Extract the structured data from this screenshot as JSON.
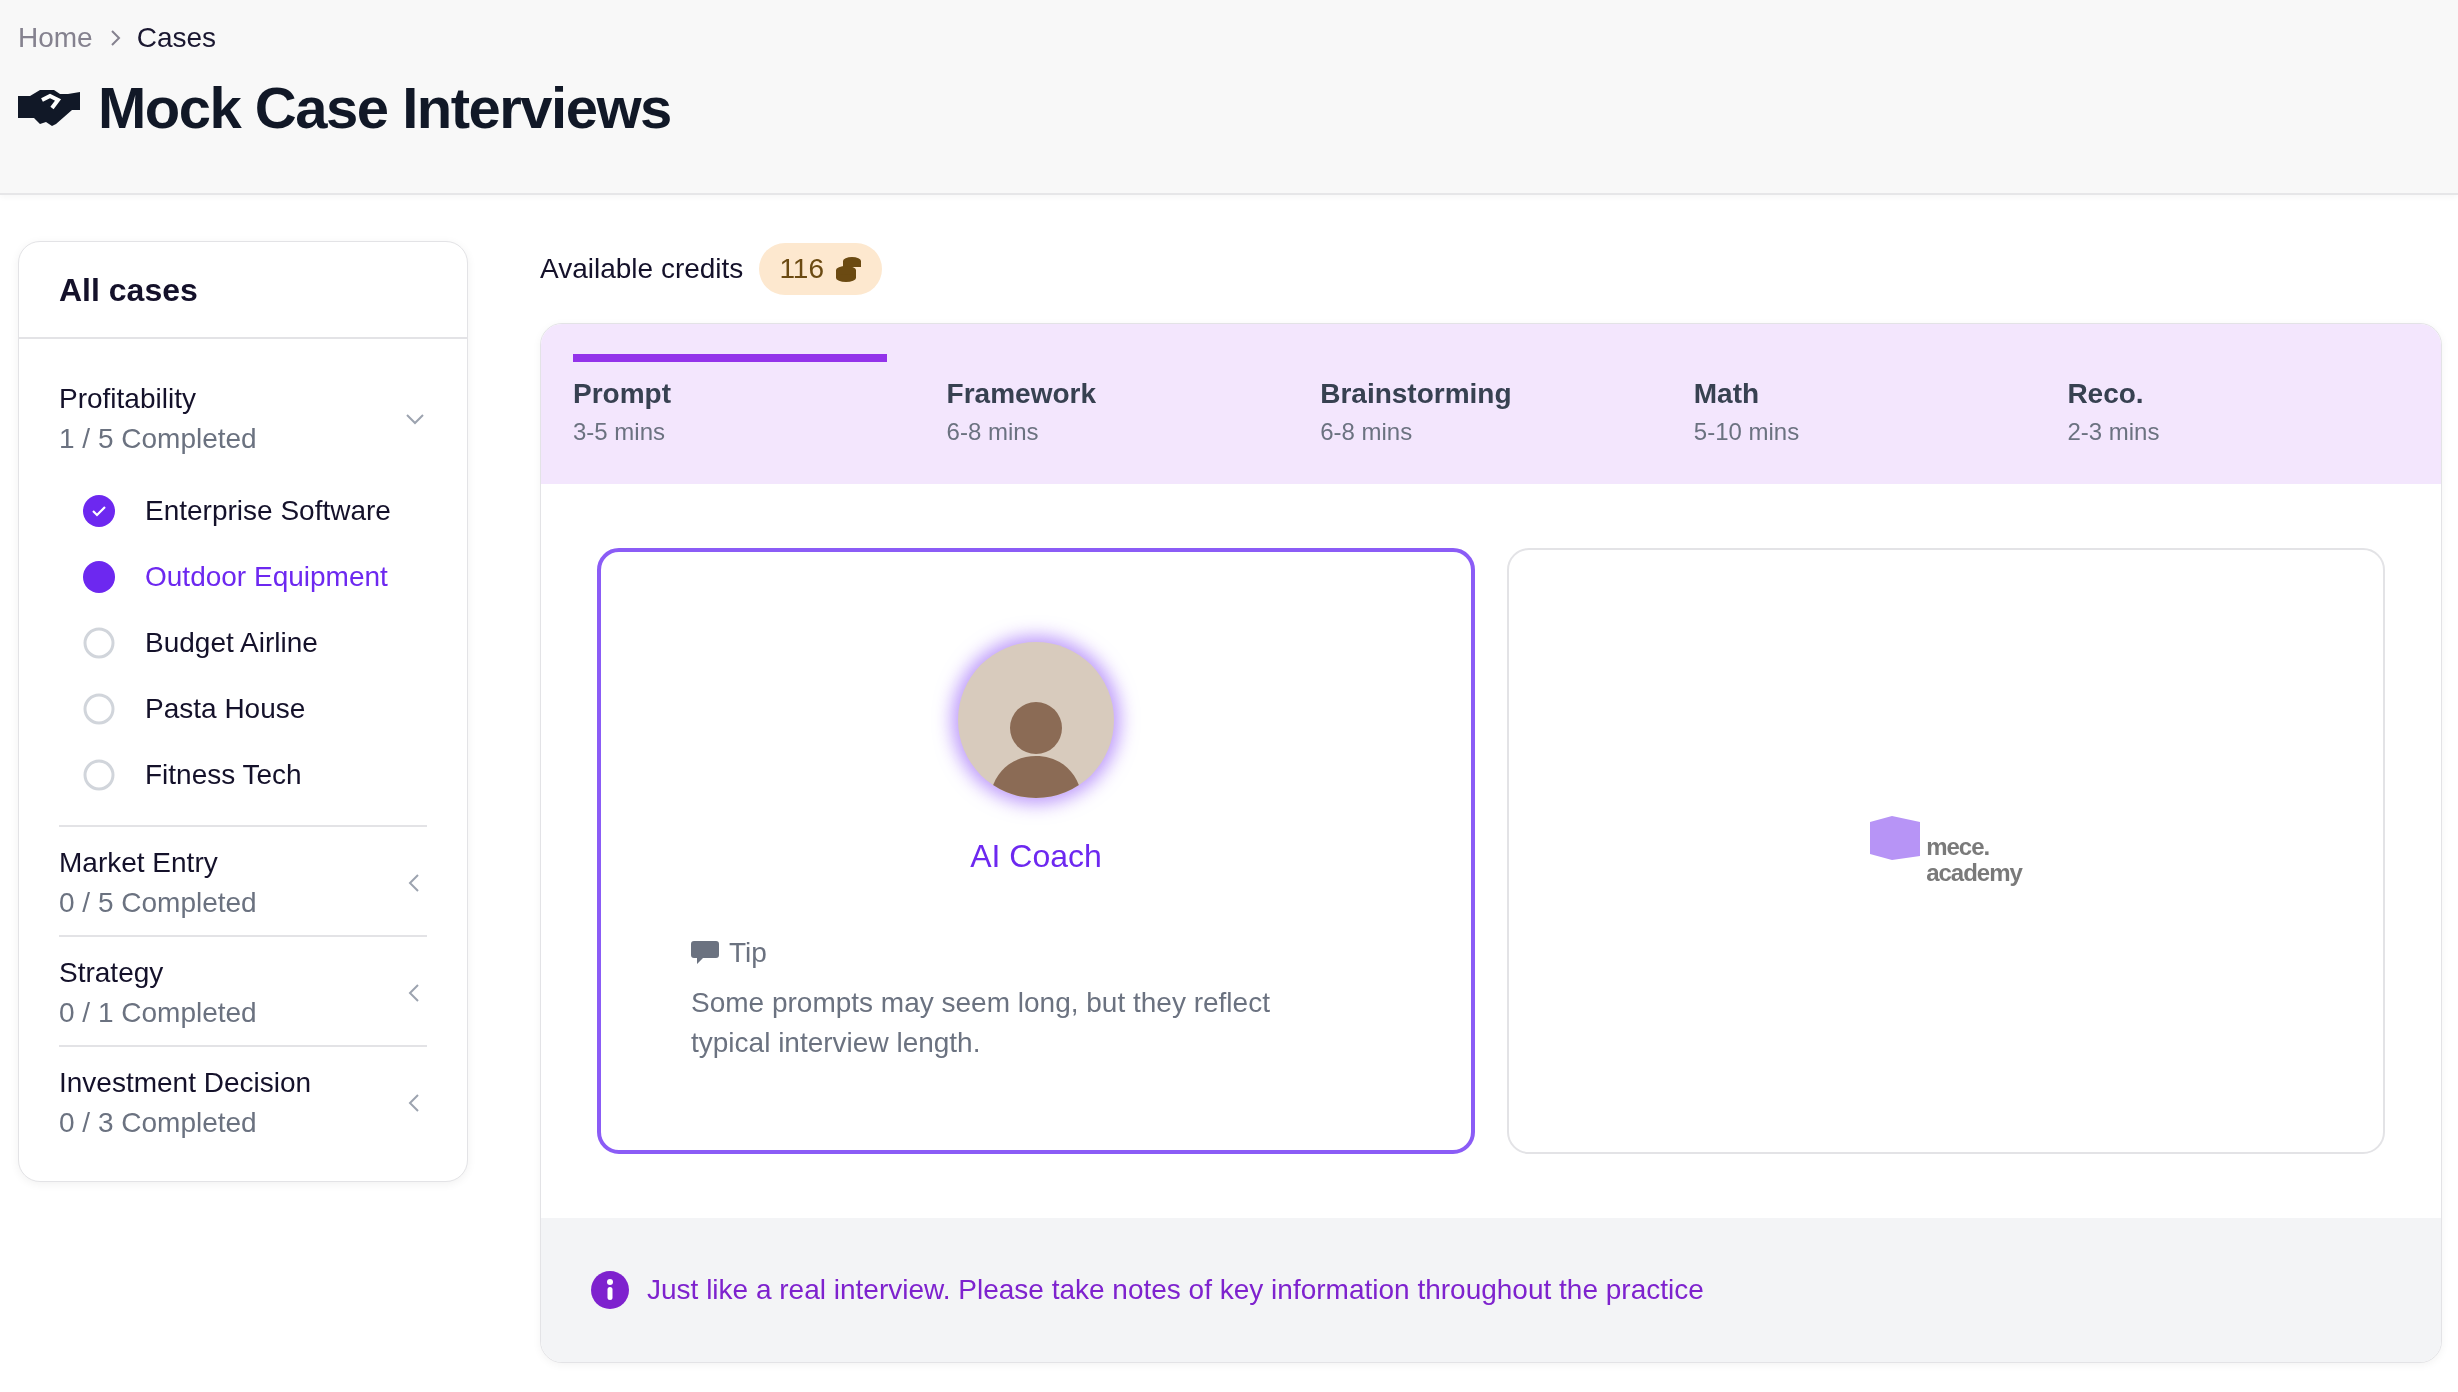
{
  "breadcrumb": [
    {
      "label": "Home",
      "current": false
    },
    {
      "label": "Cases",
      "current": true
    }
  ],
  "page_title": "Mock Case Interviews",
  "sidebar": {
    "title": "All cases",
    "groups": [
      {
        "name": "Profitability",
        "progress": "1 / 5 Completed",
        "expanded": true,
        "cases": [
          {
            "name": "Enterprise Software",
            "completed": true,
            "selected": false
          },
          {
            "name": "Outdoor Equipment",
            "completed": false,
            "selected": true
          },
          {
            "name": "Budget Airline",
            "completed": false,
            "selected": false
          },
          {
            "name": "Pasta House",
            "completed": false,
            "selected": false
          },
          {
            "name": "Fitness Tech",
            "completed": false,
            "selected": false
          }
        ]
      },
      {
        "name": "Market Entry",
        "progress": "0 / 5 Completed",
        "expanded": false
      },
      {
        "name": "Strategy",
        "progress": "0 / 1 Completed",
        "expanded": false
      },
      {
        "name": "Investment Decision",
        "progress": "0 / 3 Completed",
        "expanded": false
      }
    ]
  },
  "credits": {
    "label": "Available credits",
    "value": "116"
  },
  "steps": [
    {
      "title": "Prompt",
      "duration": "3-5 mins",
      "selected": true
    },
    {
      "title": "Framework",
      "duration": "6-8 mins",
      "selected": false
    },
    {
      "title": "Brainstorming",
      "duration": "6-8 mins",
      "selected": false
    },
    {
      "title": "Math",
      "duration": "5-10 mins",
      "selected": false
    },
    {
      "title": "Reco.",
      "duration": "2-3 mins",
      "selected": false
    }
  ],
  "coach_card": {
    "name": "AI Coach",
    "selected": true,
    "tip_label": "Tip",
    "tip_text": "Some prompts may seem long, but they reflect typical interview length."
  },
  "logo_card": {
    "lines": [
      "mece.",
      "academy"
    ]
  },
  "notice": "Just like a real interview. Please take notes of key information throughout the practice"
}
